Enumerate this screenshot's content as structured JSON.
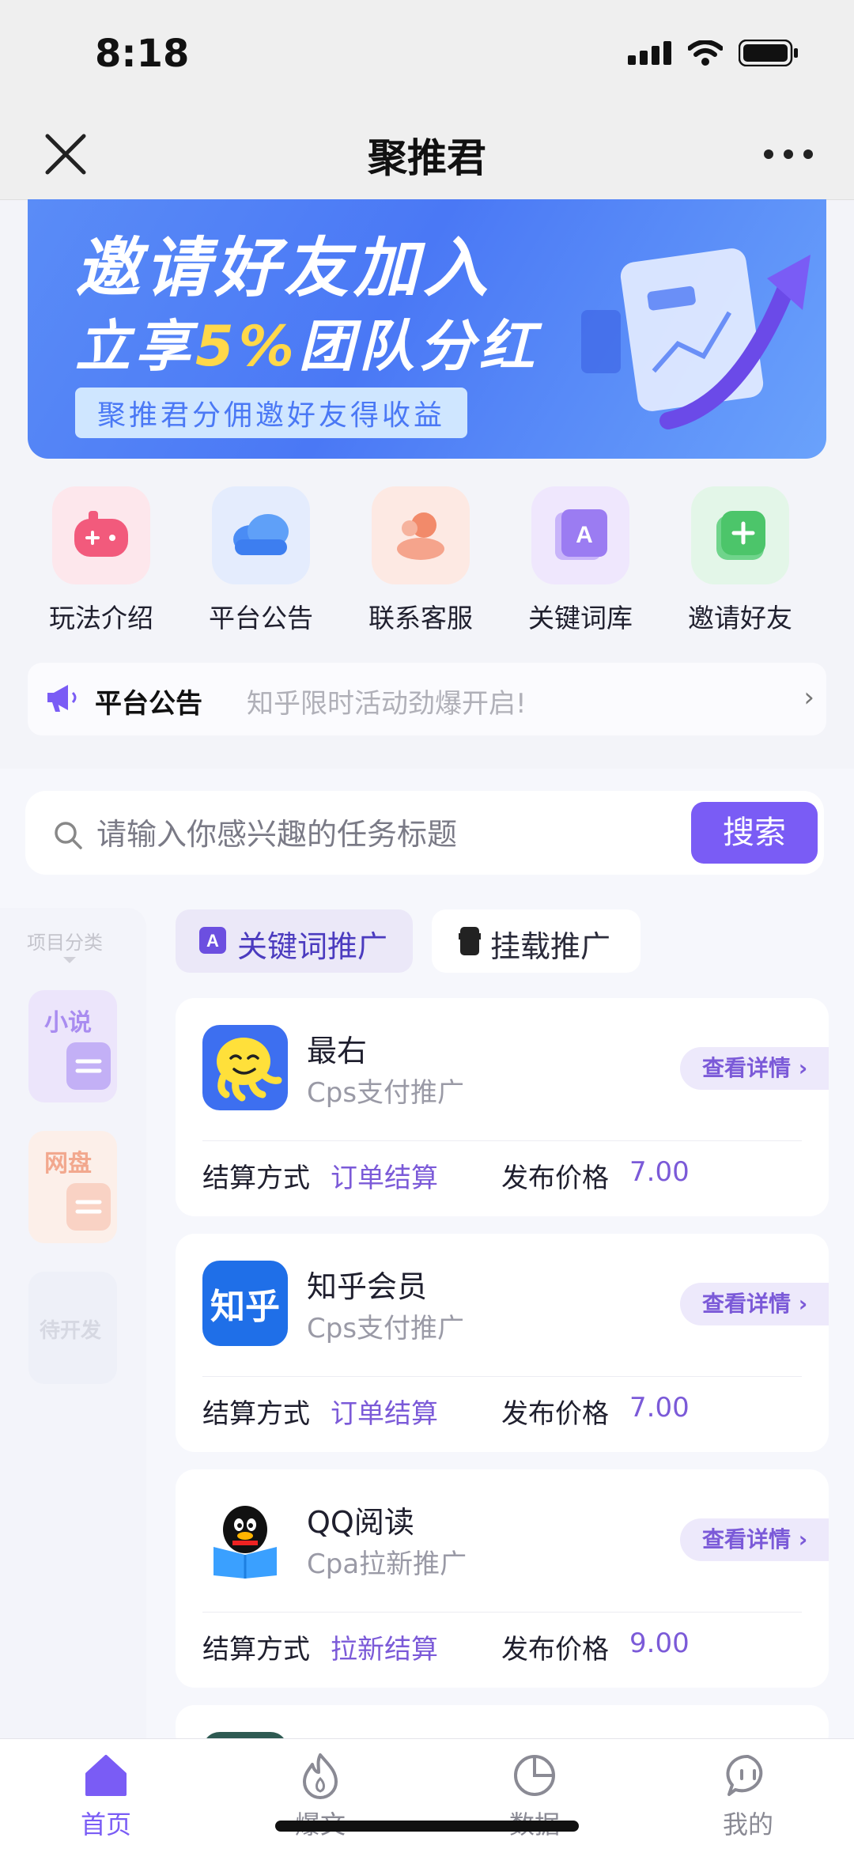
{
  "status_bar": {
    "time": "8:18"
  },
  "nav": {
    "title": "聚推君"
  },
  "banner": {
    "line1": "邀请好友加入",
    "line2_prefix": "立享",
    "line2_highlight": "5%",
    "line2_suffix": "团队分红",
    "subtitle": "聚推君分佣邀好友得收益"
  },
  "quick_menu": [
    {
      "label": "玩法介绍",
      "icon": "gamepad-icon",
      "color": "#f25a7c"
    },
    {
      "label": "平台公告",
      "icon": "cloud-icon",
      "color": "#4a8cf5"
    },
    {
      "label": "联系客服",
      "icon": "customer-service-icon",
      "color": "#f28a6a"
    },
    {
      "label": "关键词库",
      "icon": "keyword-library-icon",
      "color": "#9b7cf2"
    },
    {
      "label": "邀请好友",
      "icon": "invite-plus-icon",
      "color": "#4cc56a"
    }
  ],
  "notice": {
    "label": "平台公告",
    "text": "知乎限时活动劲爆开启!"
  },
  "search": {
    "placeholder": "请输入你感兴趣的任务标题",
    "button": "搜索"
  },
  "categories": {
    "title": "项目分类",
    "items": [
      "小说",
      "网盘",
      "待开发"
    ]
  },
  "tabs": [
    {
      "label": "关键词推广",
      "active": true
    },
    {
      "label": "挂载推广",
      "active": false
    }
  ],
  "tasks": [
    {
      "name": "最右",
      "type": "Cps支付推广",
      "detail": "查看详情",
      "settle_label": "结算方式",
      "settle_value": "订单结算",
      "price_label": "发布价格",
      "price": "7.00"
    },
    {
      "name": "知乎会员",
      "type": "Cps支付推广",
      "detail": "查看详情",
      "settle_label": "结算方式",
      "settle_value": "订单结算",
      "price_label": "发布价格",
      "price": "7.00",
      "icon_text": "知乎"
    },
    {
      "name": "QQ阅读",
      "type": "Cpa拉新推广",
      "detail": "查看详情",
      "settle_label": "结算方式",
      "settle_value": "拉新结算",
      "price_label": "发布价格",
      "price": "9.00"
    }
  ],
  "tabbar": [
    {
      "label": "首页",
      "icon": "home-icon",
      "active": true
    },
    {
      "label": "爆文",
      "icon": "flame-icon",
      "active": false
    },
    {
      "label": "数据",
      "icon": "pie-chart-icon",
      "active": false
    },
    {
      "label": "我的",
      "icon": "chat-face-icon",
      "active": false
    }
  ],
  "colors": {
    "accent": "#7a5cf5",
    "banner": "#4a78f5"
  }
}
